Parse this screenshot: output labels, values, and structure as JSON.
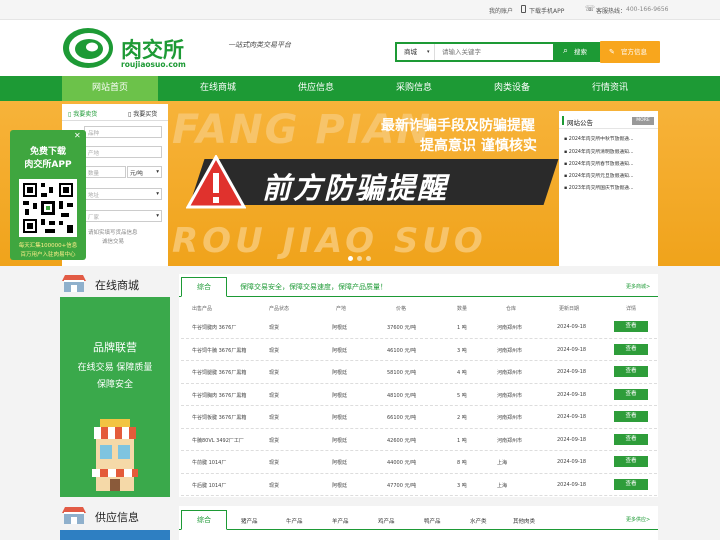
{
  "topbar": {
    "account": "我的账户",
    "app": "下载手机APP",
    "hotline_label": "客服热线：",
    "hotline": "400-166-9656"
  },
  "logo": {
    "name": "肉交所",
    "domain": "roujiaosuo.com",
    "slogan": "一站式肉类交易平台"
  },
  "search": {
    "scope": "商城",
    "placeholder": "请输入关键字",
    "button": "搜索",
    "post_button": "官方信息"
  },
  "nav": [
    "网站首页",
    "在线商城",
    "供应信息",
    "采购信息",
    "肉类设备",
    "行情资讯"
  ],
  "form": {
    "tabs": [
      "我要卖货",
      "我要买货"
    ],
    "fields": [
      "品种",
      "产地",
      "数量",
      "地址",
      "厂家"
    ],
    "unit": "元/吨",
    "note1": "请如实填写货品信息",
    "note2": "诚信交易"
  },
  "banner": {
    "bg_text1": "FANG PIAN",
    "bg_text2": "ROU JIAO SUO",
    "line1": "最新诈骗手段及防骗提醒",
    "line2": "提高意识  谨慎核实",
    "main": "前方防骗提醒"
  },
  "notices": {
    "title": "网站公告",
    "more": "MORE",
    "items": [
      "2024年肉交所中秋节放假通...",
      "2024年肉交所清明放假通知...",
      "2024年肉交所春节放假通知...",
      "2024年肉交所元旦放假通知...",
      "2023年肉交所国庆节放假通..."
    ]
  },
  "popup": {
    "title1": "免费下载",
    "title2": "肉交所APP",
    "desc1": "每天汇集100000+信息",
    "desc2": "百万用户入驻肉易中心",
    "close": "✕"
  },
  "mall": {
    "title": "在线商城",
    "tab": "综合",
    "tagline": "保障交易安全，保障交易速度，保障产品质量！",
    "more": "更多商城>",
    "promo": {
      "l1": "品牌联营",
      "l2": "在线交易 保障质量",
      "l3": "保障安全"
    },
    "headers": [
      "出售产品",
      "产品状态",
      "产地",
      "价格",
      "数量",
      "仓库",
      "更新日期",
      "详情"
    ],
    "rows": [
      [
        "牛谷饲腱肉 3676厂",
        "现货",
        "阿根廷",
        "37600 元/吨",
        "1 吨",
        "河南郑州市",
        "2024-09-18",
        "查看"
      ],
      [
        "牛谷饲牛腩 3676厂黑箱",
        "现货",
        "阿根廷",
        "46100 元/吨",
        "3 吨",
        "河南郑州市",
        "2024-09-18",
        "查看"
      ],
      [
        "牛谷饲腿腱 3676厂黑箱",
        "现货",
        "阿根廷",
        "58100 元/吨",
        "4 吨",
        "河南郑州市",
        "2024-09-18",
        "查看"
      ],
      [
        "牛谷饲胸肉 3676厂黑箱",
        "现货",
        "阿根廷",
        "48100 元/吨",
        "5 吨",
        "河南郑州市",
        "2024-09-18",
        "查看"
      ],
      [
        "牛谷饲板腱 3676厂黑箱",
        "现货",
        "阿根廷",
        "66100 元/吨",
        "2 吨",
        "河南郑州市",
        "2024-09-18",
        "查看"
      ],
      [
        "牛腩80VL 3492厂工厂",
        "现货",
        "阿根廷",
        "42600 元/吨",
        "1 吨",
        "河南郑州市",
        "2024-09-18",
        "查看"
      ],
      [
        "牛前腱 1014厂",
        "现货",
        "阿根廷",
        "44000 元/吨",
        "8 吨",
        "上海",
        "2024-09-18",
        "查看"
      ],
      [
        "牛后腱 1014厂",
        "现货",
        "阿根廷",
        "47700 元/吨",
        "3 吨",
        "上海",
        "2024-09-18",
        "查看"
      ]
    ]
  },
  "supply": {
    "title": "供应信息",
    "tabs": [
      "综合",
      "猪产品",
      "牛产品",
      "羊产品",
      "鸡产品",
      "鸭产品",
      "水产类",
      "其他肉类"
    ],
    "more": "更多供应>"
  },
  "colors": {
    "green": "#1d9a35",
    "light_green": "#6cc24a",
    "orange": "#f8a61d"
  }
}
